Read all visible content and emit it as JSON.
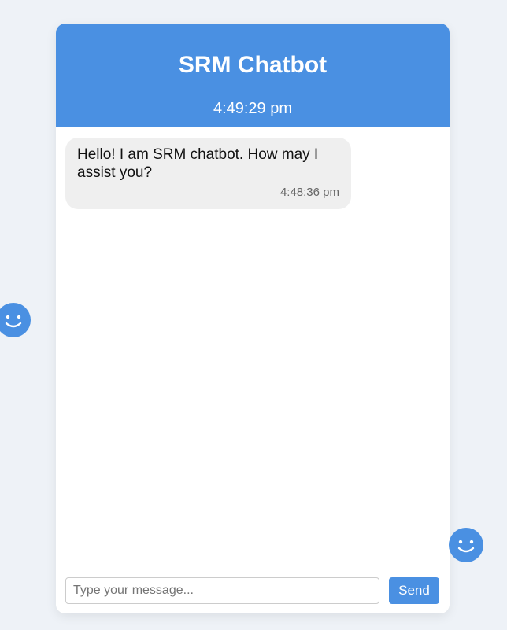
{
  "header": {
    "title": "SRM Chatbot",
    "clock": "4:49:29 pm"
  },
  "messages": [
    {
      "sender": "bot",
      "text": "Hello! I am SRM chatbot. How may I assist you?",
      "time": "4:48:36 pm"
    }
  ],
  "input": {
    "placeholder": "Type your message...",
    "value": "",
    "send_label": "Send"
  },
  "decorations": {
    "left_icon": "smiley-face-icon",
    "right_icon": "smiley-face-icon"
  },
  "colors": {
    "accent": "#4a90e2",
    "page_background": "#eef2f7",
    "bot_bubble": "#efefef"
  }
}
